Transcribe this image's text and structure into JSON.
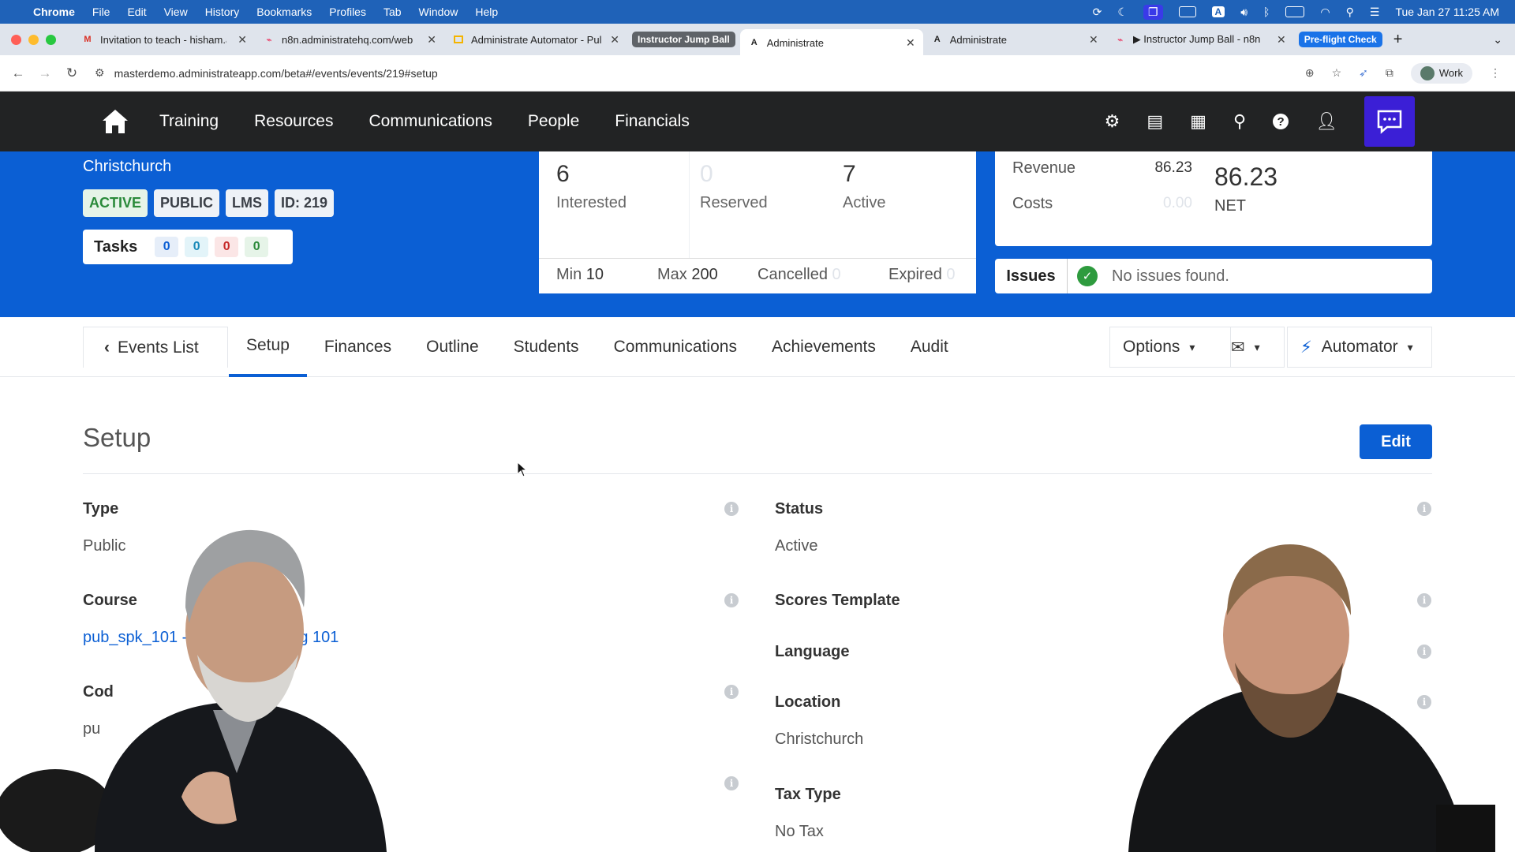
{
  "menubar": {
    "app": "Chrome",
    "menus": [
      "File",
      "Edit",
      "View",
      "History",
      "Bookmarks",
      "Profiles",
      "Tab",
      "Window",
      "Help"
    ],
    "clock": "Tue Jan 27  11:25 AM"
  },
  "tabs": [
    {
      "title": "Invitation to teach - hisham.a",
      "icon": "gmail-icon"
    },
    {
      "title": "n8n.administratehq.com/web",
      "icon": "n8n-icon"
    },
    {
      "title": "Administrate Automator - Pul",
      "icon": "slides-icon"
    },
    {
      "group": "Instructor Jump Ball",
      "group_color": "#5f6368"
    },
    {
      "title": "Administrate",
      "icon": "administrate-icon",
      "active": true
    },
    {
      "title": "Administrate",
      "icon": "administrate-icon"
    },
    {
      "title": "▶ Instructor Jump Ball - n8n",
      "icon": "n8n-icon"
    },
    {
      "group": "Pre-flight Check",
      "group_color": "#1a73e8"
    }
  ],
  "address": {
    "url": "masterdemo.administrateapp.com/beta#/events/events/219#setup",
    "profile": "Work"
  },
  "appnav": {
    "items": [
      "Training",
      "Resources",
      "Communications",
      "People",
      "Financials"
    ]
  },
  "event": {
    "city": "Christchurch",
    "badges": [
      "ACTIVE",
      "PUBLIC",
      "LMS",
      "ID: 219"
    ],
    "tasks_label": "Tasks",
    "task_counts": [
      "0",
      "0",
      "0",
      "0"
    ],
    "stats": {
      "interested": "6",
      "interested_label": "Interested",
      "reserved": "0",
      "reserved_label": "Reserved",
      "active": "7",
      "active_label": "Active",
      "min_label": "Min",
      "min": "10",
      "max_label": "Max",
      "max": "200",
      "cancelled_label": "Cancelled",
      "cancelled": "0",
      "expired_label": "Expired",
      "expired": "0"
    },
    "finance": {
      "revenue_label": "Revenue",
      "revenue": "86.23",
      "costs_label": "Costs",
      "costs": "0.00",
      "net": "86.23",
      "net_label": "NET"
    },
    "issues_label": "Issues",
    "issues_text": "No issues found."
  },
  "subnav": {
    "back": "Events List",
    "tabs": [
      "Setup",
      "Finances",
      "Outline",
      "Students",
      "Communications",
      "Achievements",
      "Audit"
    ],
    "options": "Options",
    "automator": "Automator"
  },
  "setup": {
    "title": "Setup",
    "edit": "Edit",
    "left_fields": [
      {
        "label": "Type",
        "value": "Public"
      },
      {
        "label": "Course",
        "value": "pub_spk_101 -",
        "value_tail": "g 101"
      },
      {
        "label": "Cod",
        "value": "pu"
      }
    ],
    "right_fields": [
      {
        "label": "Status",
        "value": "Active"
      },
      {
        "label": "Scores Template",
        "value": ""
      },
      {
        "label": "Language",
        "value": ""
      },
      {
        "label": "Location",
        "value": "Christchurch"
      },
      {
        "label": "Tax Type",
        "value": "No Tax"
      }
    ]
  },
  "colors": {
    "menubar": "#1f62b8",
    "appnav": "#222324",
    "brand_blue": "#0b5fd4",
    "chat_button": "#3b1fd6"
  }
}
